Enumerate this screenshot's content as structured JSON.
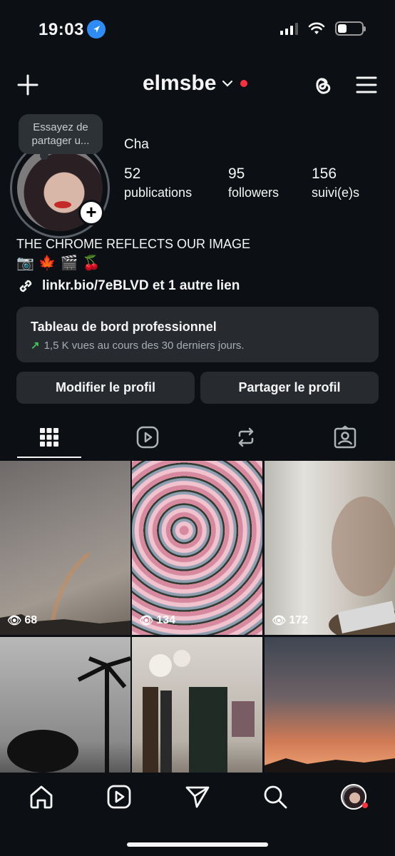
{
  "status_bar": {
    "time": "19:03"
  },
  "header": {
    "username": "elmsbe"
  },
  "profile": {
    "note": "Essayez de partager u...",
    "display_name": "Cha",
    "stats": [
      {
        "value": "52",
        "label": "publications"
      },
      {
        "value": "95",
        "label": "followers"
      },
      {
        "value": "156",
        "label": "suivi(e)s"
      }
    ],
    "bio": "THE CHROME REFLECTS OUR IMAGE",
    "emojis": [
      "📷",
      "🍁",
      "🎬",
      "🍒"
    ],
    "link": "linkr.bio/7eBLVD et 1 autre lien"
  },
  "dashboard": {
    "title": "Tableau de bord professionnel",
    "subtitle": "1,5 K vues au cours des 30 derniers jours."
  },
  "buttons": {
    "edit": "Modifier le profil",
    "share": "Partager le profil"
  },
  "grid": {
    "posts": [
      {
        "views": "68"
      },
      {
        "views": "134"
      },
      {
        "views": "172"
      },
      {
        "views": ""
      },
      {
        "views": ""
      },
      {
        "views": ""
      }
    ]
  },
  "colors": {
    "background": "#0c1014",
    "surface": "#272b30",
    "accent_red": "#ff3040",
    "trend_green": "#41c15a"
  }
}
